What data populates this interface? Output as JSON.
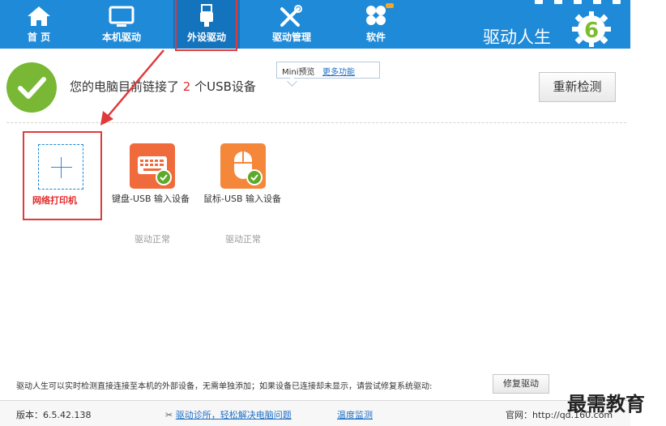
{
  "nav": [
    {
      "label": "首 页",
      "icon": "home-icon"
    },
    {
      "label": "本机驱动",
      "icon": "monitor-icon"
    },
    {
      "label": "外设驱动",
      "icon": "usb-icon",
      "active": true
    },
    {
      "label": "驱动管理",
      "icon": "wrench-icon"
    },
    {
      "label": "软件",
      "icon": "clover-icon"
    }
  ],
  "brand": {
    "name": "驱动人生",
    "logo_digit": "6"
  },
  "status": {
    "prefix": "您的电脑目前链接了",
    "count": "2",
    "suffix": "个USB设备"
  },
  "mini_popup": {
    "label": "Mini预览",
    "more": "更多功能"
  },
  "rescan_button": "重新检测",
  "devices": {
    "add": {
      "label": "网络打印机"
    },
    "items": [
      {
        "name": "键盘-USB 输入设备",
        "status": "驱动正常",
        "icon": "keyboard-icon",
        "color": "#f06b3c"
      },
      {
        "name": "鼠标-USB 输入设备",
        "status": "驱动正常",
        "icon": "mouse-icon",
        "color": "#f5873a"
      }
    ]
  },
  "footer_note": "驱动人生可以实时检测直接连接至本机的外部设备，无需单独添加；如果设备已连接却未显示，请尝试修复系统驱动:",
  "repair_button": "修复驱动",
  "bottom": {
    "version": "版本：6.5.42.138",
    "diag_link": "驱动诊所，轻松解决电脑问题",
    "temp_link": "温度监测",
    "site": "官网：http://qd.160.com"
  },
  "watermark": "最需教育",
  "colors": {
    "topbar": "#1f8ad8",
    "highlight": "#e03a3a",
    "check": "#5ea92a"
  }
}
